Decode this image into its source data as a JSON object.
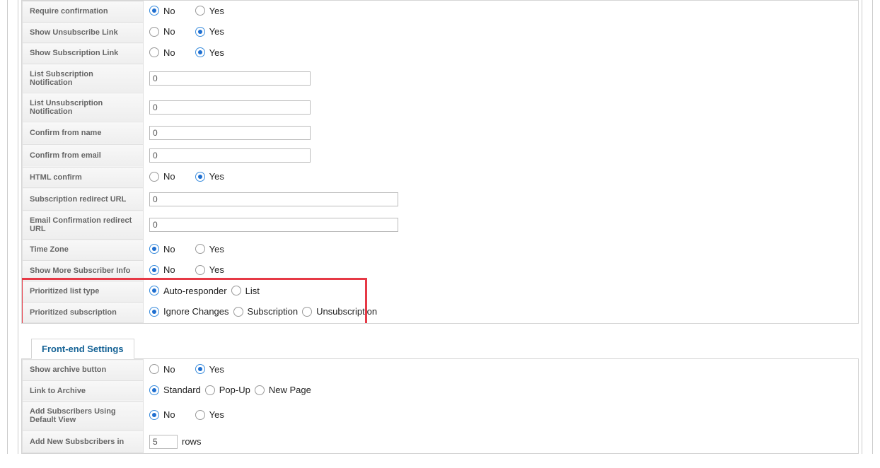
{
  "section1": {
    "rows": [
      {
        "label": "Require confirmation",
        "type": "radio_ny",
        "selected": "No"
      },
      {
        "label": "Show Unsubscribe Link",
        "type": "radio_ny",
        "selected": "Yes"
      },
      {
        "label": "Show Subscription Link",
        "type": "radio_ny",
        "selected": "Yes"
      },
      {
        "label": "List Subscription Notification",
        "type": "text_short",
        "value": "0"
      },
      {
        "label": "List Unsubscription Notification",
        "type": "text_short",
        "value": "0"
      },
      {
        "label": "Confirm from name",
        "type": "text_short",
        "value": "0"
      },
      {
        "label": "Confirm from email",
        "type": "text_short",
        "value": "0"
      },
      {
        "label": "HTML confirm",
        "type": "radio_ny",
        "selected": "Yes"
      },
      {
        "label": "Subscription redirect URL",
        "type": "text_long",
        "value": "0"
      },
      {
        "label": "Email Confirmation redirect URL",
        "type": "text_long",
        "value": "0"
      },
      {
        "label": "Time Zone",
        "type": "radio_ny",
        "selected": "No"
      },
      {
        "label": "Show More Subscriber Info",
        "type": "radio_ny",
        "selected": "No"
      },
      {
        "label": "Prioritized list type",
        "type": "radio_custom_tight",
        "options": [
          "Auto-responder",
          "List"
        ],
        "selected": "Auto-responder"
      },
      {
        "label": "Prioritized subscription",
        "type": "radio_custom_tight",
        "options": [
          "Ignore Changes",
          "Subscription",
          "Unsubscription"
        ],
        "selected": "Ignore Changes"
      }
    ],
    "ny_options": [
      "No",
      "Yes"
    ]
  },
  "section2": {
    "tab_label": "Front-end Settings",
    "rows": [
      {
        "label": "Show archive button",
        "type": "radio_ny",
        "selected": "Yes"
      },
      {
        "label": "Link to Archive",
        "type": "radio_custom_tight",
        "options": [
          "Standard",
          "Pop-Up",
          "New Page"
        ],
        "selected": "Standard"
      },
      {
        "label": "Add Subscribers Using Default View",
        "type": "radio_ny",
        "selected": "No"
      },
      {
        "label": "Add New Subsbcribers in",
        "type": "text_tiny_rows",
        "value": "5",
        "suffix": "rows"
      }
    ],
    "ny_options": [
      "No",
      "Yes"
    ]
  }
}
